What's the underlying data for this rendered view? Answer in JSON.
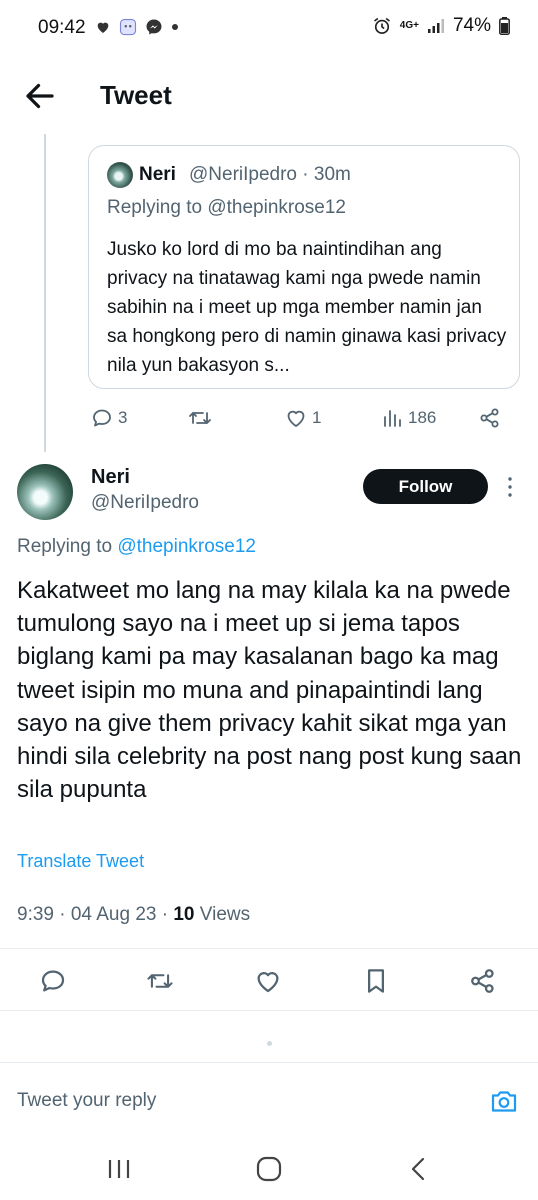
{
  "status_bar": {
    "time": "09:42",
    "left_icons": [
      "heart-icon",
      "app-icon",
      "messenger-icon",
      "dot-icon"
    ],
    "network": "4G+",
    "battery": "74%"
  },
  "header": {
    "title": "Tweet"
  },
  "quoted_tweet": {
    "name": "Neri",
    "handle_time": "@NeriIpedro · 30m",
    "replying_to": "Replying to @thepinkrose12",
    "text": "Jusko ko lord di mo ba naintindihan ang privacy na tinatawag kami nga pwede namin sabihin na i meet up mga member namin jan sa hongkong pero di namin ginawa kasi privacy nila yun bakasyon s...",
    "actions": {
      "replies": "3",
      "likes": "1",
      "views": "186"
    }
  },
  "tweet": {
    "name": "Neri",
    "handle": "@NeriIpedro",
    "follow_label": "Follow",
    "replying_prefix": "Replying to ",
    "replying_mention": "@thepinkrose12",
    "text": "Kakatweet mo lang na may kilala ka na pwede tumulong sayo na i meet up si jema tapos biglang kami pa may kasalanan bago ka mag tweet isipin mo muna and pinapaintindi lang sayo na give them privacy kahit sikat mga yan hindi sila celebrity na post nang post kung saan sila pupunta",
    "translate_label": "Translate Tweet",
    "timestamp": "9:39 · 04 Aug 23 · ",
    "views_count": "10",
    "views_label": " Views"
  },
  "reply_composer": {
    "placeholder": "Tweet your reply"
  },
  "colors": {
    "accent": "#1d9bf0",
    "text": "#0f1419",
    "muted": "#536471",
    "border": "#cfd9de"
  }
}
